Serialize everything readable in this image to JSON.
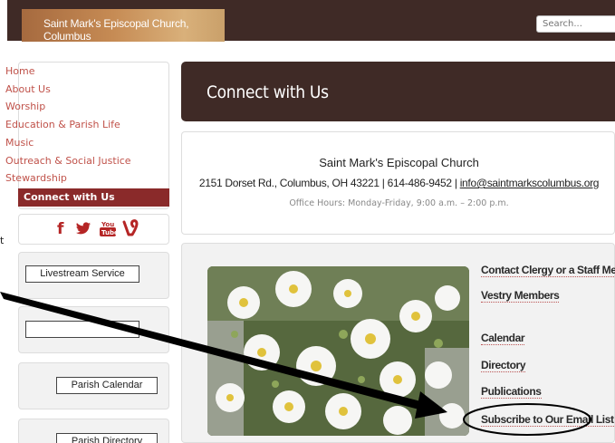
{
  "header": {
    "logo_text": "Saint Mark's Episcopal Church, Columbus",
    "search_placeholder": "Search..."
  },
  "sidebar": {
    "items": [
      {
        "label": "Home"
      },
      {
        "label": "About Us"
      },
      {
        "label": "Worship"
      },
      {
        "label": "Education & Parish Life"
      },
      {
        "label": "Music"
      },
      {
        "label": "Outreach & Social Justice"
      },
      {
        "label": "Stewardship"
      }
    ],
    "active_label": "Connect with Us",
    "social_icons": [
      "facebook-icon",
      "twitter-icon",
      "youtube-icon",
      "vine-icon"
    ],
    "buttons": {
      "livestream": "Livestream Service",
      "calendar": "Parish Calendar",
      "directory": "Parish Directory"
    }
  },
  "main": {
    "title": "Connect with Us",
    "info": {
      "name": "Saint Mark's Episcopal Church",
      "address": "2151 Dorset Rd., Columbus, OH 43221 | 614-486-9452 | ",
      "email": "info@saintmarkscolumbus.org",
      "hours": "Office Hours: Monday-Friday, 9:00 a.m. – 2:00 p.m."
    },
    "links": [
      "Contact Clergy or a Staff Member",
      "Vestry Members",
      "Calendar",
      "Directory",
      "Publications",
      "Subscribe to Our Email List"
    ]
  },
  "annotation": {
    "edge_text": "t",
    "color": "#000000"
  },
  "colors": {
    "brand_dark": "#3f2a26",
    "nav_link": "#c0524a",
    "nav_active": "#8a2a2a",
    "social": "#b52525"
  }
}
